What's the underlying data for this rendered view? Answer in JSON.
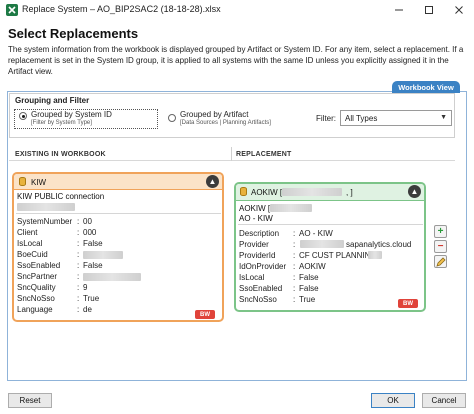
{
  "window": {
    "title": "Replace System – AO_BIP2SAC2 (18-18-28).xlsx"
  },
  "heading": "Select Replacements",
  "description": "The system information from the workbook is displayed grouped by Artifact or System ID. For any item, select a replacement. If a replacement is set in the System ID group, it is applied to all systems with the same ID unless you explicitly assigned it in the Artifact view.",
  "view_tab": "Workbook View",
  "grouping": {
    "title": "Grouping and Filter",
    "by_system": {
      "label": "Grouped by System ID",
      "sub": "[Filter by System Type]",
      "selected": true
    },
    "by_artifact": {
      "label": "Grouped by Artifact",
      "sub": "[Data Sources | Planning Artifacts]",
      "selected": false
    },
    "filter_label": "Filter:",
    "filter_value": "All Types"
  },
  "columns": {
    "existing": "EXISTING IN WORKBOOK",
    "replacement": "REPLACEMENT"
  },
  "existing": {
    "header": "KIW",
    "name": "KIW PUBLIC connection",
    "props": [
      {
        "key": "SystemNumber",
        "value": "00"
      },
      {
        "key": "Client",
        "value": "000"
      },
      {
        "key": "IsLocal",
        "value": "False"
      },
      {
        "key": "BoeCuid",
        "value": ""
      },
      {
        "key": "SsoEnabled",
        "value": "False"
      },
      {
        "key": "SncPartner",
        "value": ""
      },
      {
        "key": "SncQuality",
        "value": "9"
      },
      {
        "key": "SncNoSso",
        "value": "True"
      },
      {
        "key": "Language",
        "value": "de"
      }
    ],
    "badge": "BW"
  },
  "replacement": {
    "header": "AOKIW [",
    "header_end": ", ]",
    "line1": "AOKIW [",
    "line2": "AO - KIW",
    "props": [
      {
        "key": "Description",
        "value": "AO - KIW"
      },
      {
        "key": "Provider",
        "value": "sapanalytics.cloud"
      },
      {
        "key": "ProviderId",
        "value": "CF CUST PLANNING"
      },
      {
        "key": "IdOnProvider",
        "value": "AOKIW"
      },
      {
        "key": "IsLocal",
        "value": "False"
      },
      {
        "key": "SsoEnabled",
        "value": "False"
      },
      {
        "key": "SncNoSso",
        "value": "True"
      }
    ],
    "badge": "BW"
  },
  "side_actions": {
    "add": "+",
    "remove": "−"
  },
  "buttons": {
    "reset": "Reset",
    "ok": "OK",
    "cancel": "Cancel"
  },
  "colors": {
    "accent": "#3b82c4",
    "existing_border": "#f0a35a",
    "replacement_border": "#7cc488",
    "badge": "#e0433a"
  }
}
